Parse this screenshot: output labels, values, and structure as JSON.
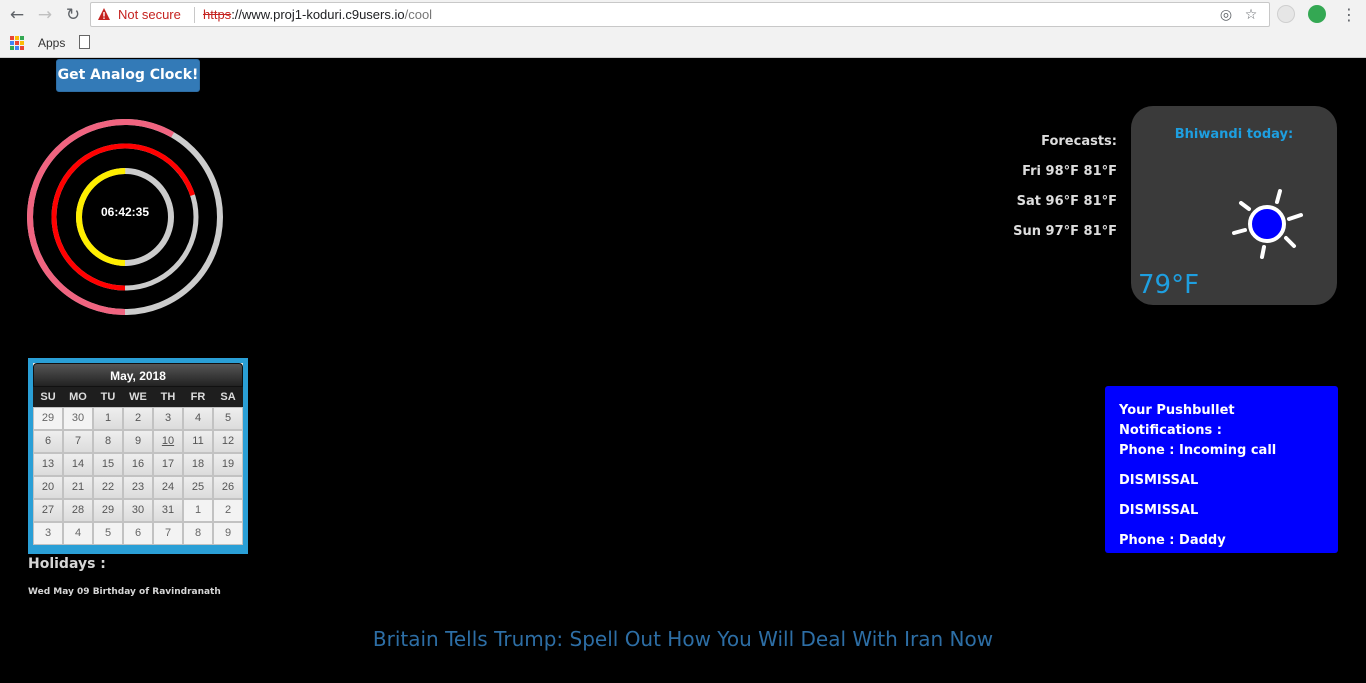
{
  "browser": {
    "security_label": "Not secure",
    "url_scheme": "https",
    "url_sep": "://",
    "url_host": "www.proj1-koduri.c9users.io",
    "url_path": "/cool",
    "bookmarks": {
      "apps_label": "Apps"
    },
    "colors": {
      "warning": "#c5221f"
    }
  },
  "page": {
    "analog_clock_button": "Get Analog Clock!",
    "clock": {
      "time_text": "06:42:35",
      "colors": {
        "hours": "#ffee00",
        "minutes": "#ff0000",
        "seconds": "#f06480",
        "track": "#cccccc"
      }
    },
    "calendar": {
      "month_label": "May, 2018",
      "weekdays": [
        "SU",
        "MO",
        "TU",
        "WE",
        "TH",
        "FR",
        "SA"
      ],
      "weeks": [
        [
          "29",
          "30",
          "1",
          "2",
          "3",
          "4",
          "5"
        ],
        [
          "6",
          "7",
          "8",
          "9",
          "10",
          "11",
          "12"
        ],
        [
          "13",
          "14",
          "15",
          "16",
          "17",
          "18",
          "19"
        ],
        [
          "20",
          "21",
          "22",
          "23",
          "24",
          "25",
          "26"
        ],
        [
          "27",
          "28",
          "29",
          "30",
          "31",
          "1",
          "2"
        ],
        [
          "3",
          "4",
          "5",
          "6",
          "7",
          "8",
          "9"
        ]
      ],
      "today": "10"
    },
    "holidays": {
      "title": "Holidays :",
      "items": [
        "Wed May 09 Birthday of Ravindranath"
      ]
    },
    "forecasts": {
      "title": "Forecasts:",
      "days": [
        "Fri 98°F 81°F",
        "Sat 96°F 81°F",
        "Sun 97°F 81°F"
      ]
    },
    "weather": {
      "city_label": "Bhiwandi today:",
      "temperature": "79°F",
      "icon": "sun-icon"
    },
    "pushbullet": {
      "title": "Your Pushbullet Notifications :",
      "items": [
        "Phone : Incoming call",
        "DISMISSAL",
        "DISMISSAL",
        "Phone : Daddy"
      ]
    },
    "headline": "Britain Tells Trump: Spell Out How You Will Deal With Iran Now"
  }
}
